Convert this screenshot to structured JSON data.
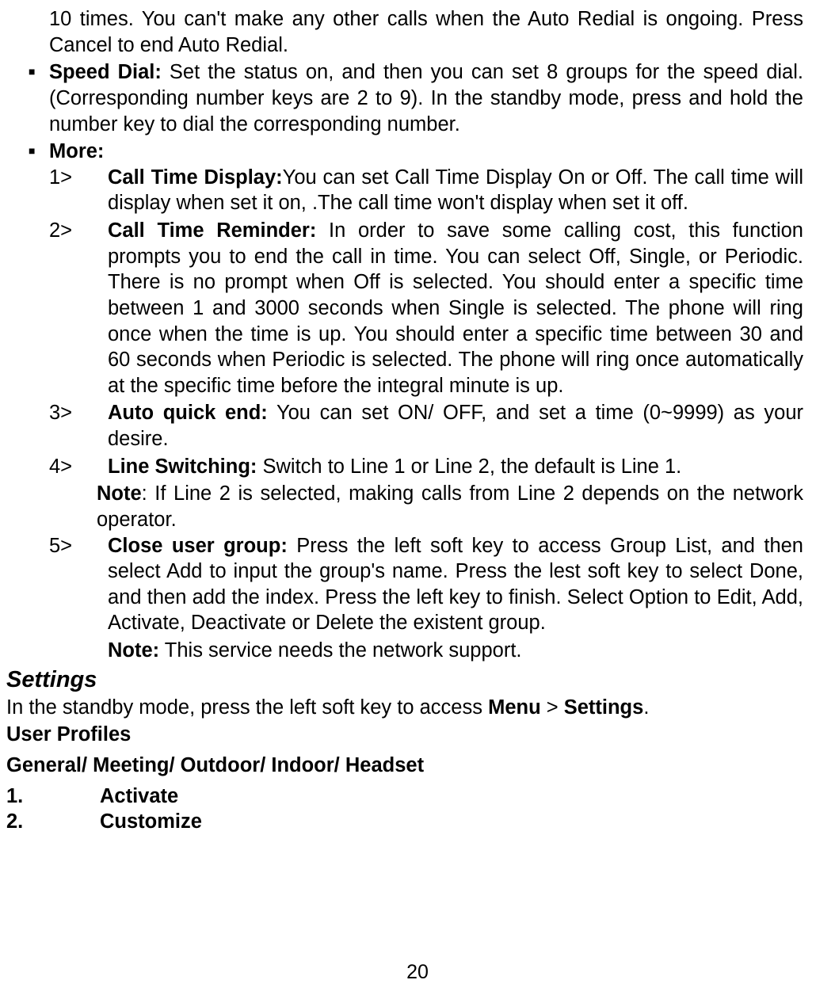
{
  "first_para": "10 times. You can't make any other calls when the Auto Redial is ongoing. Press Cancel to end Auto Redial.",
  "bullets": [
    {
      "label": "Speed Dial: ",
      "text": "Set the status on, and then you can set 8 groups for the speed dial. (Corresponding number keys are 2 to 9). In the standby mode, press and hold the number key to dial the corresponding number."
    },
    {
      "label": "More:",
      "numbered": [
        {
          "n": "1>",
          "label": "Call Time Display:",
          "text": "You can set Call Time Display On or Off. The call time will display when set it on, .The call time won't display when set it off."
        },
        {
          "n": "2>",
          "label": "Call Time Reminder:",
          "text": " In order to save some calling cost, this function prompts you to end the call in time. You can select Off, Single, or Periodic. There is no prompt when Off is selected. You should enter a specific time between 1 and 3000 seconds when Single is selected. The phone will ring once when the time is up. You should enter a specific time between 30 and 60 seconds when Periodic is selected. The phone will ring once automatically at the specific time before the integral minute is up."
        },
        {
          "n": "3>",
          "label": "Auto quick end:",
          "text": " You can set ON/ OFF, and set a time (0~9999) as your desire."
        },
        {
          "n": "4>",
          "label": "Line Switching:",
          "text": " Switch to Line 1 or Line 2, the default is Line 1.",
          "note_label": "Note",
          "note_text": ": If Line 2 is selected, making calls from Line 2 depends on the network operator."
        },
        {
          "n": "5>",
          "label": "Close user group:",
          "text": " Press the left soft key to access Group List, and then select Add to input the group's name. Press the lest soft key to select Done, and then add the index. Press the left key to finish. Select Option to Edit, Add, Activate, Deactivate or Delete the existent group.",
          "note2_label": "Note:",
          "note2_text": " This service needs the network support."
        }
      ]
    }
  ],
  "settings_title": "Settings",
  "settings_intro_pre": "In the standby mode, press the left soft key to access ",
  "settings_intro_b1": "Menu",
  "settings_intro_mid": " > ",
  "settings_intro_b2": "Settings",
  "settings_intro_end": ".",
  "user_profiles": "User Profiles",
  "profiles_line": "General/ Meeting/ Outdoor/ Indoor/ Headset",
  "final_list": [
    {
      "n": "1.",
      "label": "Activate"
    },
    {
      "n": "2.",
      "label": "Customize"
    }
  ],
  "page_number": "20"
}
